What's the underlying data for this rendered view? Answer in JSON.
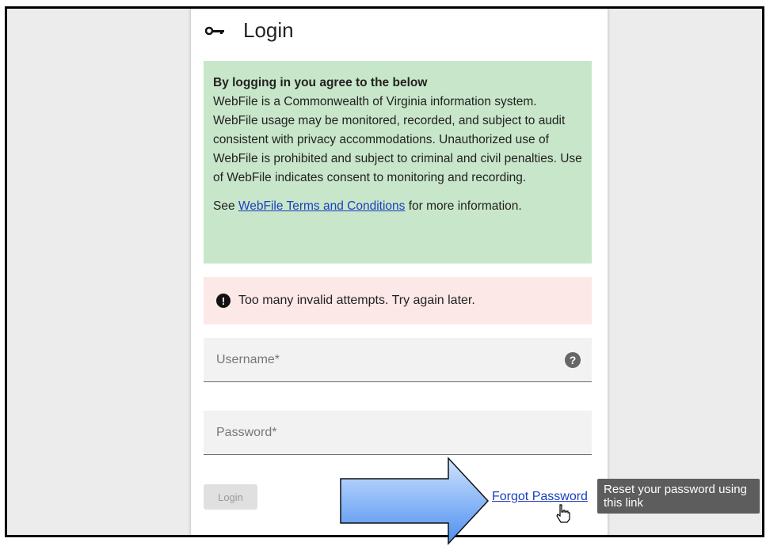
{
  "login_card": {
    "title": "Login",
    "icon": "key-icon",
    "notice": {
      "heading": "By logging in you agree to the below",
      "body": "WebFile is a Commonwealth of Virginia information system. WebFile usage may be monitored, recorded, and subject to audit consistent with privacy accommodations. Unauthorized use of WebFile is prohibited and subject to criminal and civil penalties. Use of WebFile indicates consent to monitoring and recording.",
      "more_prefix": "See ",
      "more_link": "WebFile Terms and Conditions",
      "more_suffix": " for more information.",
      "background": "#c8e6c9"
    },
    "error": {
      "message": "Too many invalid attempts. Try again later.",
      "background": "#fde8e8"
    },
    "username": {
      "placeholder": "Username*",
      "value": ""
    },
    "password": {
      "placeholder": "Password*",
      "value": ""
    },
    "login_button": "Login",
    "forgot_link": "Forgot Password"
  },
  "tooltip": {
    "text": "Reset your password using this link"
  },
  "colors": {
    "link": "#1a3fbf",
    "callout_arrow": "#7fb4f5"
  }
}
